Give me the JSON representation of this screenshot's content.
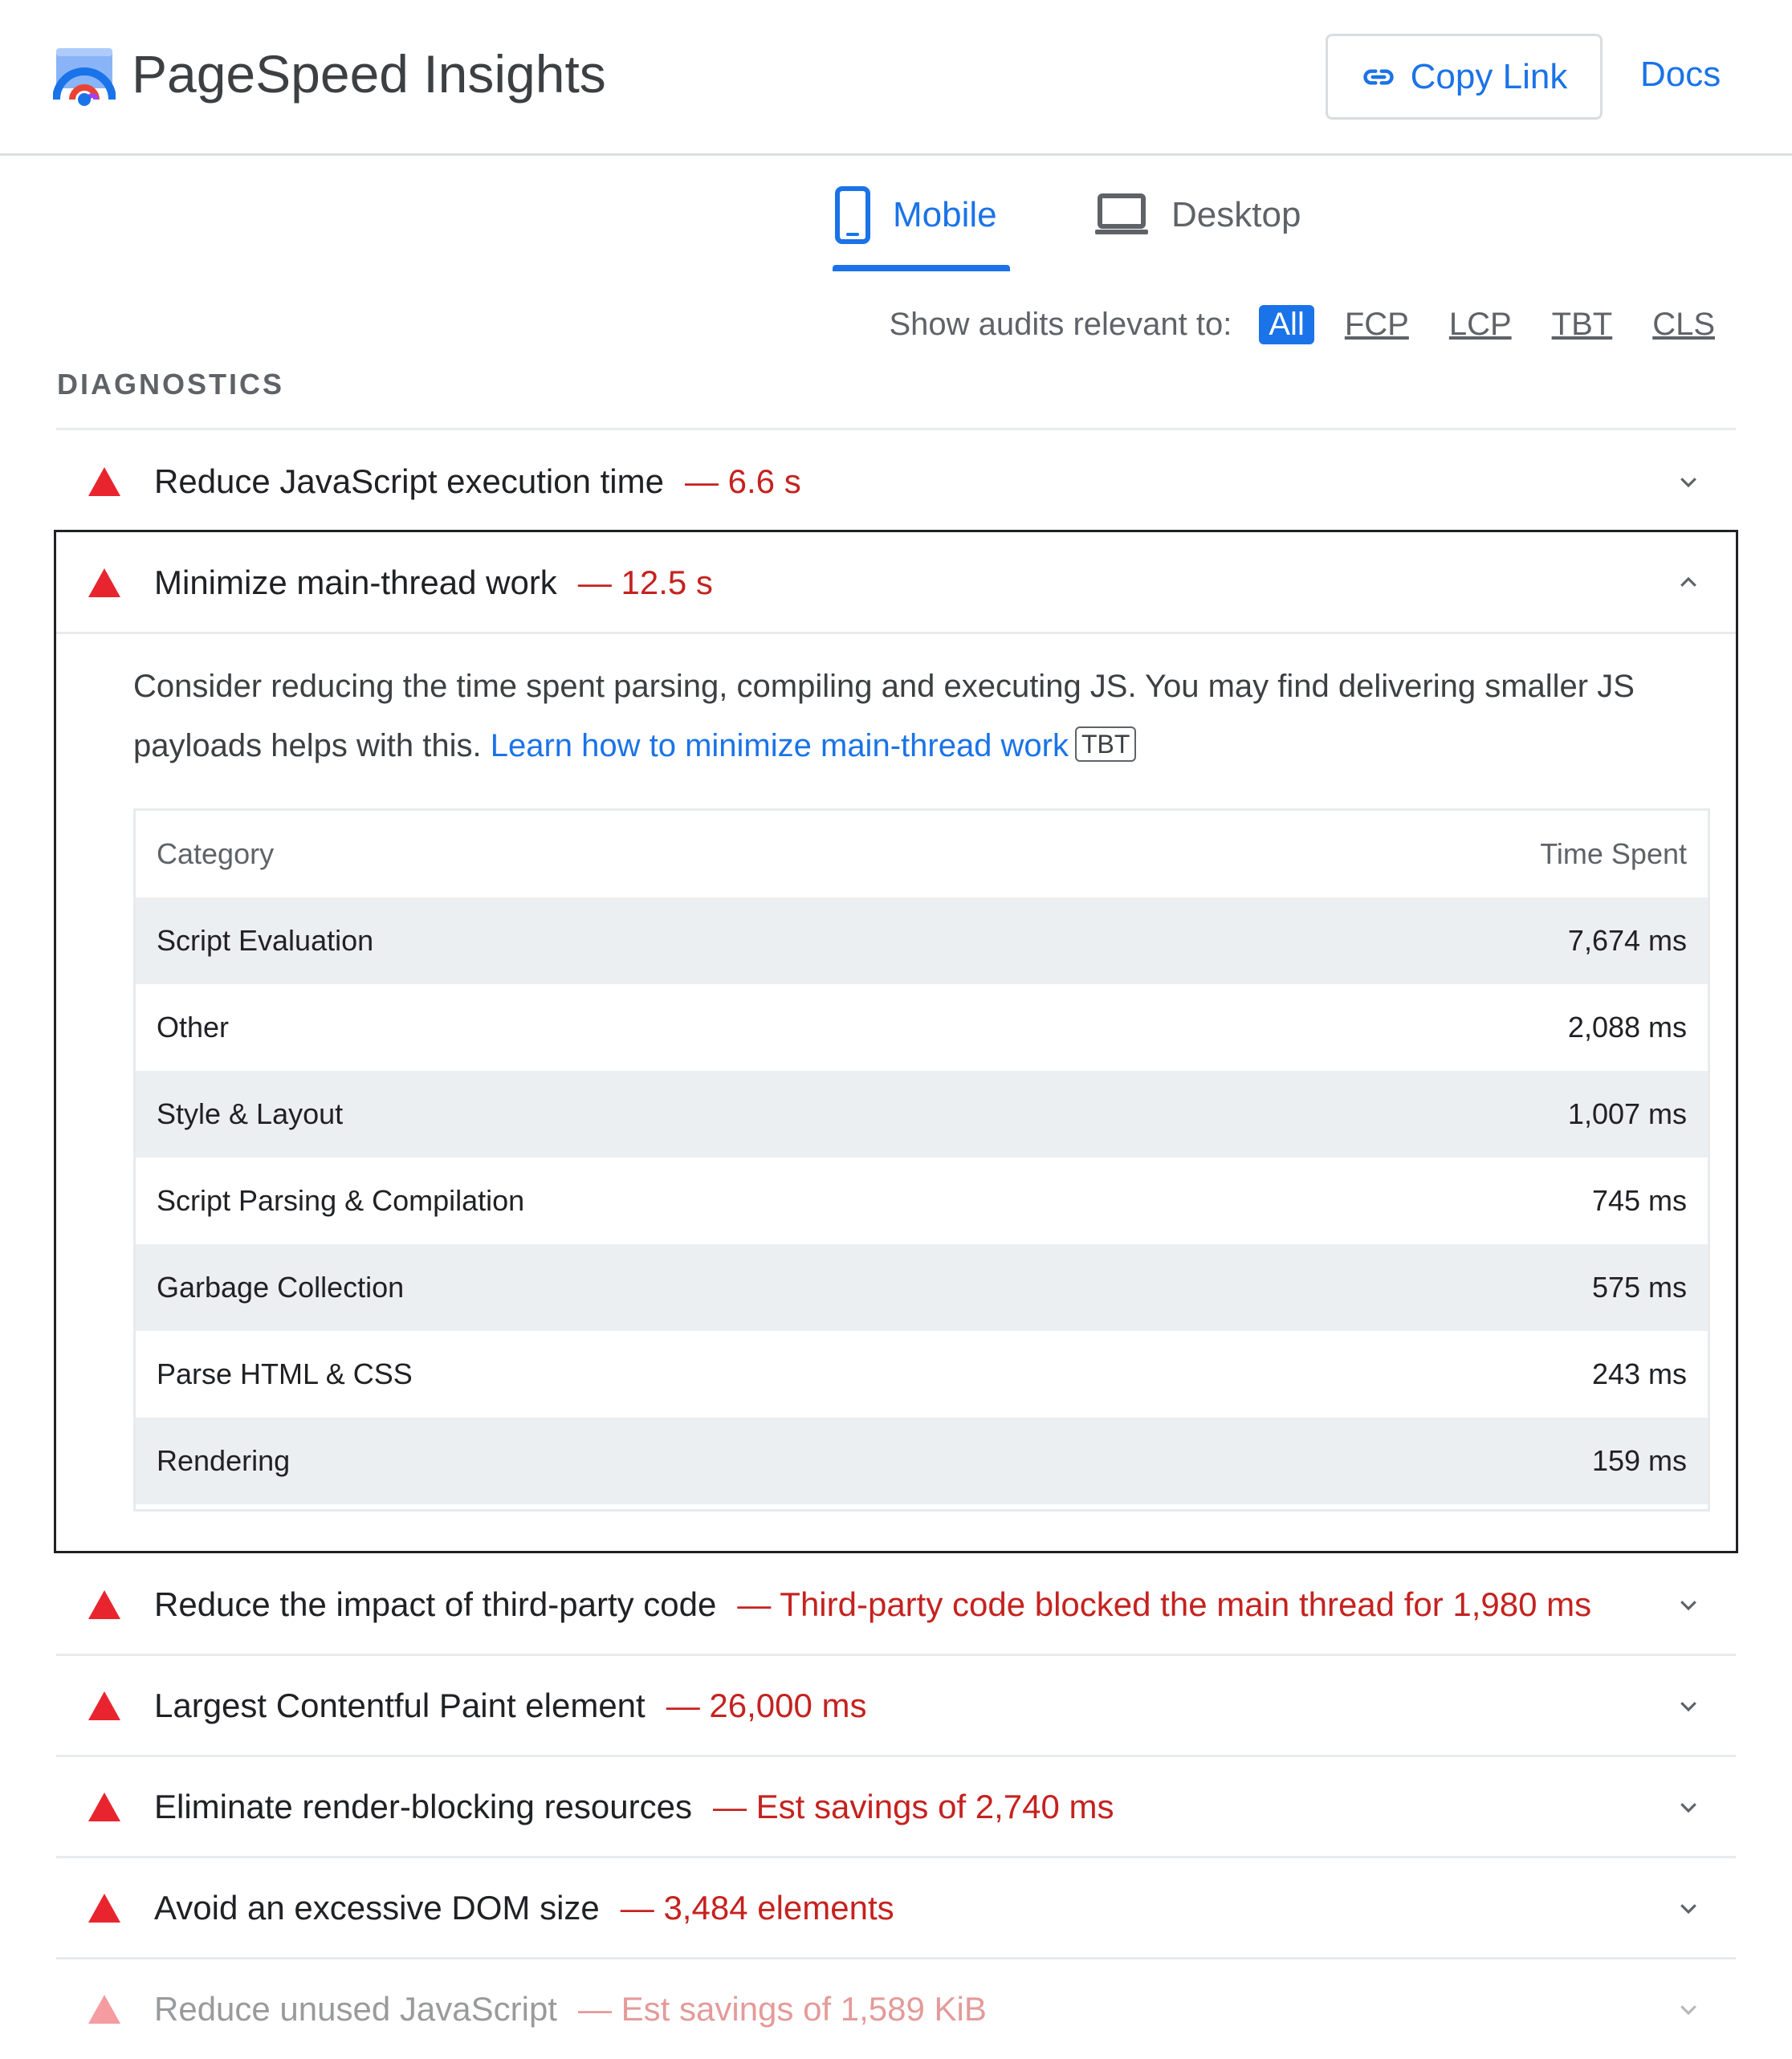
{
  "header": {
    "title": "PageSpeed Insights",
    "copy_link_label": "Copy Link",
    "docs_label": "Docs"
  },
  "tabs": [
    {
      "label": "Mobile",
      "icon": "smartphone-icon",
      "selected": true
    },
    {
      "label": "Desktop",
      "icon": "laptop-icon",
      "selected": false
    }
  ],
  "filter": {
    "label": "Show audits relevant to:",
    "options": [
      "All",
      "FCP",
      "LCP",
      "TBT",
      "CLS"
    ],
    "selected": "All"
  },
  "section_title": "DIAGNOSTICS",
  "audits": [
    {
      "title": "Reduce JavaScript execution time",
      "value": "— 6.6 s",
      "expanded": false
    },
    {
      "title": "Minimize main-thread work",
      "value": "— 12.5 s",
      "expanded": true
    },
    {
      "title": "Reduce the impact of third-party code",
      "value": "— Third-party code blocked the main thread for 1,980 ms",
      "expanded": false
    },
    {
      "title": "Largest Contentful Paint element",
      "value": "— 26,000 ms",
      "expanded": false
    },
    {
      "title": "Eliminate render-blocking resources",
      "value": "— Est savings of 2,740 ms",
      "expanded": false
    },
    {
      "title": "Avoid an excessive DOM size",
      "value": "— 3,484 elements",
      "expanded": false
    },
    {
      "title": "Reduce unused JavaScript",
      "value": "— Est savings of 1,589 KiB",
      "expanded": false
    }
  ],
  "expanded_audit": {
    "description": "Consider reducing the time spent parsing, compiling and executing JS. You may find delivering smaller JS payloads helps with this.",
    "link_text": "Learn how to minimize main-thread work",
    "badge": "TBT",
    "table": {
      "columns": [
        "Category",
        "Time Spent"
      ],
      "rows": [
        {
          "category": "Script Evaluation",
          "time": "7,674 ms"
        },
        {
          "category": "Other",
          "time": "2,088 ms"
        },
        {
          "category": "Style & Layout",
          "time": "1,007 ms"
        },
        {
          "category": "Script Parsing & Compilation",
          "time": "745 ms"
        },
        {
          "category": "Garbage Collection",
          "time": "575 ms"
        },
        {
          "category": "Parse HTML & CSS",
          "time": "243 ms"
        },
        {
          "category": "Rendering",
          "time": "159 ms"
        }
      ]
    }
  },
  "colors": {
    "accent": "#1a73e8",
    "fail": "#e8252f",
    "fail_text": "#c5221f"
  }
}
